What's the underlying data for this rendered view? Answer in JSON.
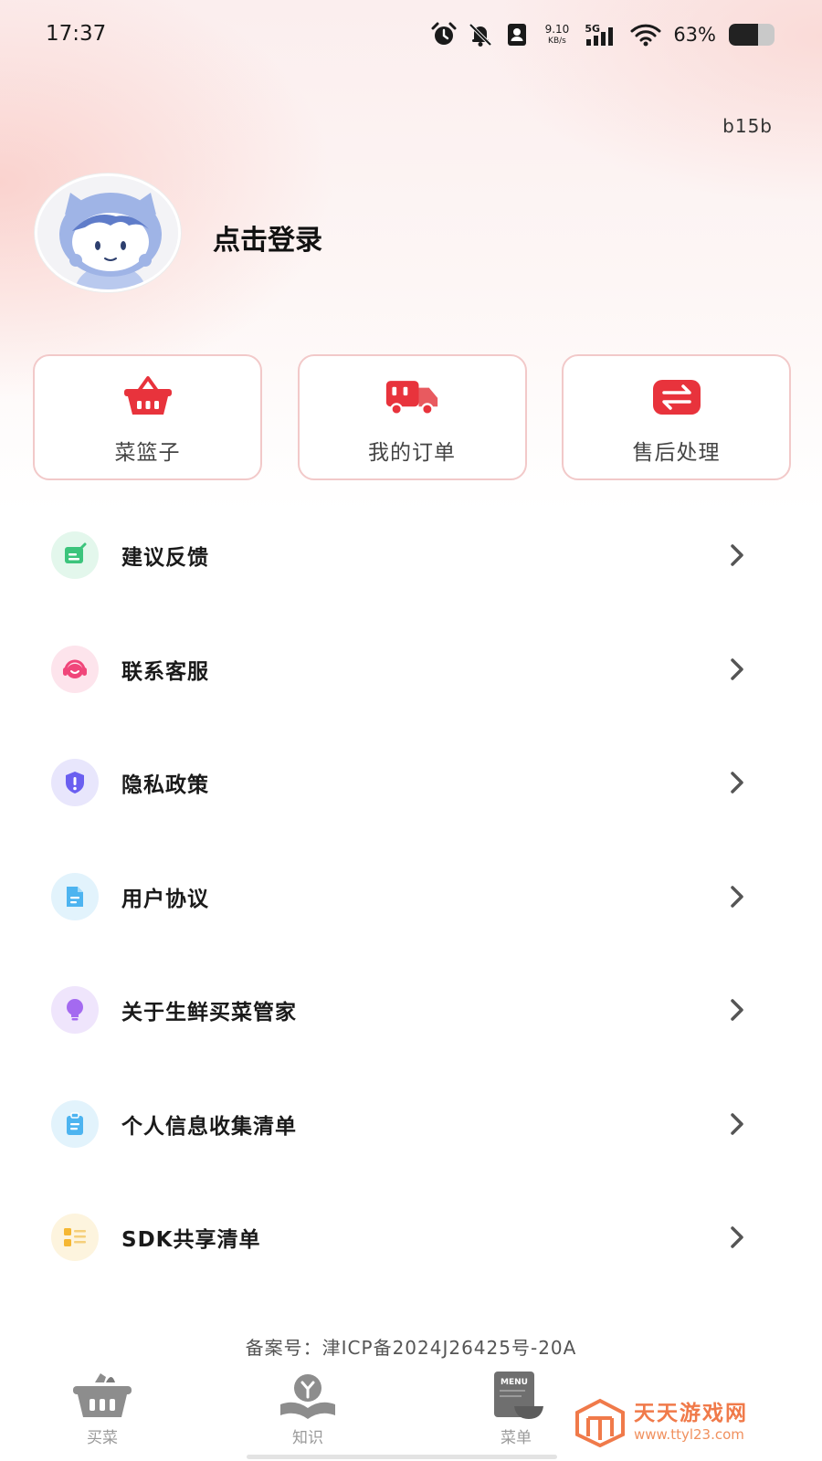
{
  "status_bar": {
    "time": "17:37",
    "net_speed_value": "9.10",
    "net_speed_unit": "KB/s",
    "network_type": "5G",
    "battery_percent": "63%",
    "battery_level": 0.63,
    "icons": [
      "alarm-icon",
      "bell-muted-icon",
      "contact-card-icon",
      "signal-icon",
      "wifi-icon",
      "battery-icon"
    ]
  },
  "header": {
    "version": "b15b",
    "login_prompt": "点击登录"
  },
  "shortcuts": [
    {
      "label": "菜篮子",
      "icon": "basket-icon"
    },
    {
      "label": "我的订单",
      "icon": "delivery-truck-icon"
    },
    {
      "label": "售后处理",
      "icon": "exchange-icon"
    }
  ],
  "menu": [
    {
      "label": "建议反馈",
      "icon": "feedback-icon",
      "color": "#3cc47c"
    },
    {
      "label": "联系客服",
      "icon": "headset-icon",
      "color": "#f0467a"
    },
    {
      "label": "隐私政策",
      "icon": "shield-icon",
      "color": "#6a5ff0"
    },
    {
      "label": "用户协议",
      "icon": "document-icon",
      "color": "#4db4f0"
    },
    {
      "label": "关于生鲜买菜管家",
      "icon": "lightbulb-icon",
      "color": "#a46af0"
    },
    {
      "label": "个人信息收集清单",
      "icon": "clipboard-icon",
      "color": "#4db4f0"
    },
    {
      "label": "SDK共享清单",
      "icon": "list-icon",
      "color": "#f5b733"
    }
  ],
  "footer": {
    "icp": "备案号：津ICP备2024J26425号-20A"
  },
  "tabs": [
    {
      "label": "买菜",
      "icon": "grocery-basket-icon"
    },
    {
      "label": "知识",
      "icon": "knowledge-book-icon"
    },
    {
      "label": "菜单",
      "icon": "menu-board-icon"
    }
  ],
  "watermark": {
    "title": "天天游戏网",
    "url": "www.ttyl23.com"
  },
  "colors": {
    "accent_red": "#e8333c",
    "card_border": "#f2c9c9",
    "tab_inactive": "#9a9a9a"
  }
}
